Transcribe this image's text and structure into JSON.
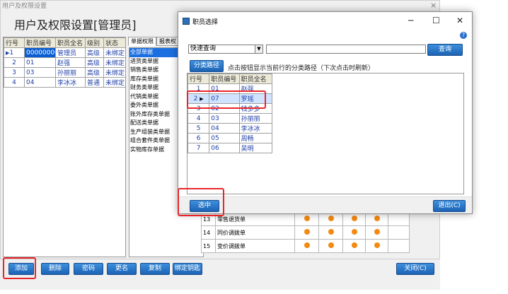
{
  "window": {
    "title": "用户及权限设置",
    "close": "×",
    "page_title": "用户及权限设置[管理员]"
  },
  "user_table": {
    "headers": [
      "行号",
      "职员编号",
      "职员全名",
      "级别",
      "状态"
    ],
    "rows": [
      {
        "no": "1",
        "code": "00000000",
        "name": "管理员",
        "level": "高级",
        "status": "未绑定"
      },
      {
        "no": "2",
        "code": "01",
        "name": "赵强",
        "level": "高级",
        "status": "未绑定"
      },
      {
        "no": "3",
        "code": "03",
        "name": "孙丽丽",
        "level": "高级",
        "status": "未绑定"
      },
      {
        "no": "4",
        "code": "04",
        "name": "李冰冰",
        "level": "普通",
        "status": "未绑定"
      }
    ]
  },
  "tabs": [
    "单据权限",
    "报表权"
  ],
  "categories": [
    "全部单据",
    "进货类单据",
    "销售类单据",
    "库存类单据",
    "财务类单据",
    "代销类单据",
    "委外类单据",
    "账外库存类单据",
    "配送类单据",
    "生产组装类单据",
    "组合套件类单据",
    "实物库存单据"
  ],
  "perm_rows": [
    {
      "no": "13",
      "name": "零售退货单"
    },
    {
      "no": "14",
      "name": "同价调拨单"
    },
    {
      "no": "15",
      "name": "变价调拨单"
    }
  ],
  "bottom_buttons": {
    "add": "添加",
    "delete": "删除",
    "password": "密码",
    "rename": "更名",
    "copy": "复制",
    "bind": "绑定钥匙",
    "close": "关闭(C)"
  },
  "dialog": {
    "title": "职员选择",
    "minimize": "─",
    "maximize": "☐",
    "close": "✕",
    "help": "?",
    "search_mode": "快速查询",
    "search_value": "",
    "search_button": "查询",
    "category_button": "分类路径",
    "hint": "点击按钮显示当前行的分类路径（下次点击时刷新）",
    "headers": [
      "行号",
      "职员编号",
      "职员全名"
    ],
    "rows": [
      {
        "no": "1",
        "code": "01",
        "name": "赵强"
      },
      {
        "no": "2",
        "code": "07",
        "name": "罗瑶"
      },
      {
        "no": "3",
        "code": "02",
        "name": "钱多多"
      },
      {
        "no": "4",
        "code": "03",
        "name": "孙丽丽"
      },
      {
        "no": "5",
        "code": "04",
        "name": "李冰冰"
      },
      {
        "no": "6",
        "code": "05",
        "name": "周畅"
      },
      {
        "no": "7",
        "code": "06",
        "name": "吴明"
      }
    ],
    "select_button": "选中",
    "exit_button": "退出(C)"
  },
  "colors": {
    "accent": "#1d62b4",
    "highlight": "#e8262a",
    "dot": "#f28a12"
  }
}
